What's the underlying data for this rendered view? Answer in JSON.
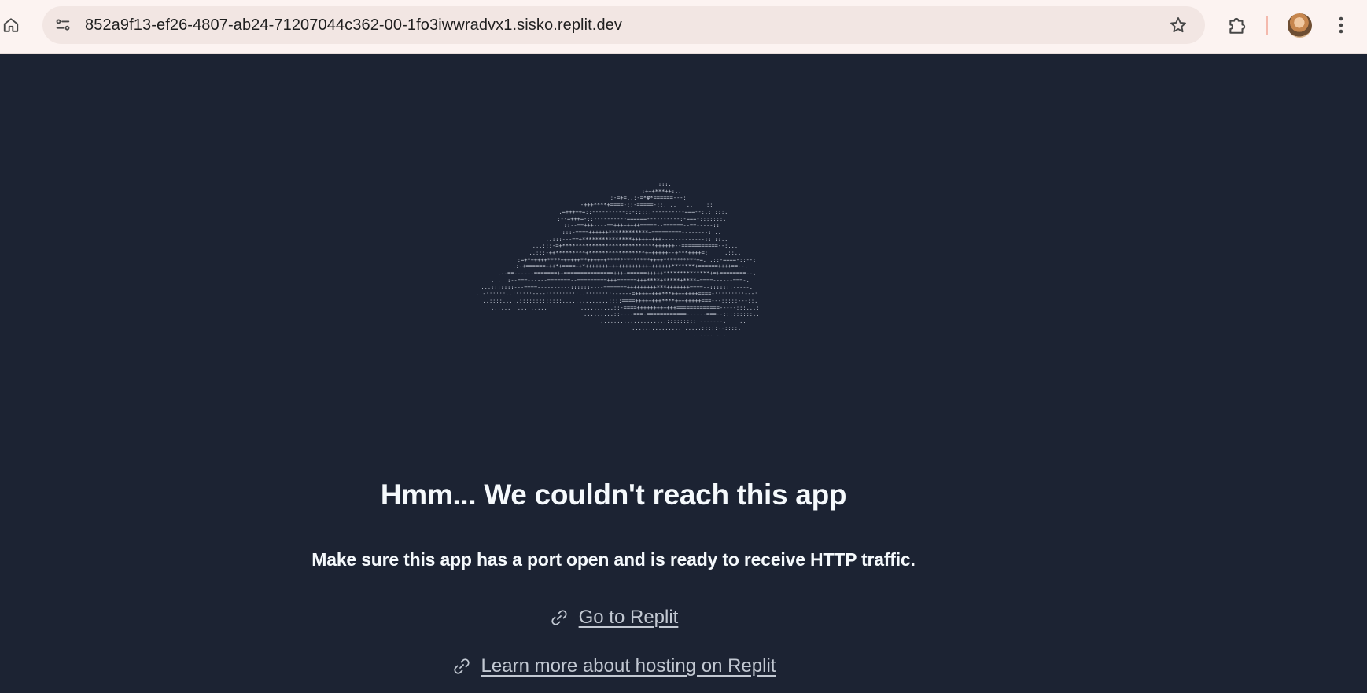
{
  "browser": {
    "url": "852a9f13-ef26-4807-ab24-71207044c362-00-1fo3iwwradvx1.sisko.replit.dev",
    "icons": {
      "home": "home-icon",
      "site_info": "site-info-icon",
      "bookmark": "star-icon",
      "extensions": "puzzle-icon",
      "profile": "avatar",
      "menu": "more-vertical-icon"
    }
  },
  "error_page": {
    "heading": "Hmm... We couldn't reach this app",
    "message": "Make sure this app has a port open and is ready to receive HTTP traffic.",
    "links": [
      {
        "label": "Go to Replit",
        "icon": "link-icon"
      },
      {
        "label": "Learn more about hosting on Replit",
        "icon": "link-icon"
      }
    ]
  },
  "colors": {
    "page_background": "#1c2333",
    "chrome_background": "#fcf3f1",
    "omnibox_background": "#f2e6e3",
    "heading_text": "#f5f9fc",
    "link_text": "#c2c8d2"
  }
}
